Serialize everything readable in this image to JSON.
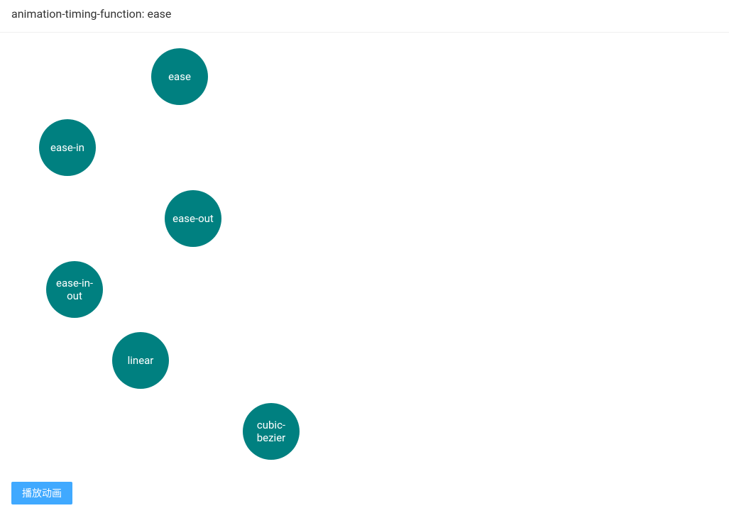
{
  "header": {
    "title": "animation-timing-function: ease"
  },
  "circles": {
    "items": [
      {
        "label": "ease"
      },
      {
        "label": "ease-in"
      },
      {
        "label": "ease-out"
      },
      {
        "label": "ease-in-out"
      },
      {
        "label": "linear"
      },
      {
        "label": "cubic-bezier"
      }
    ],
    "color": "#008080"
  },
  "footer": {
    "play_label": "播放动画"
  }
}
